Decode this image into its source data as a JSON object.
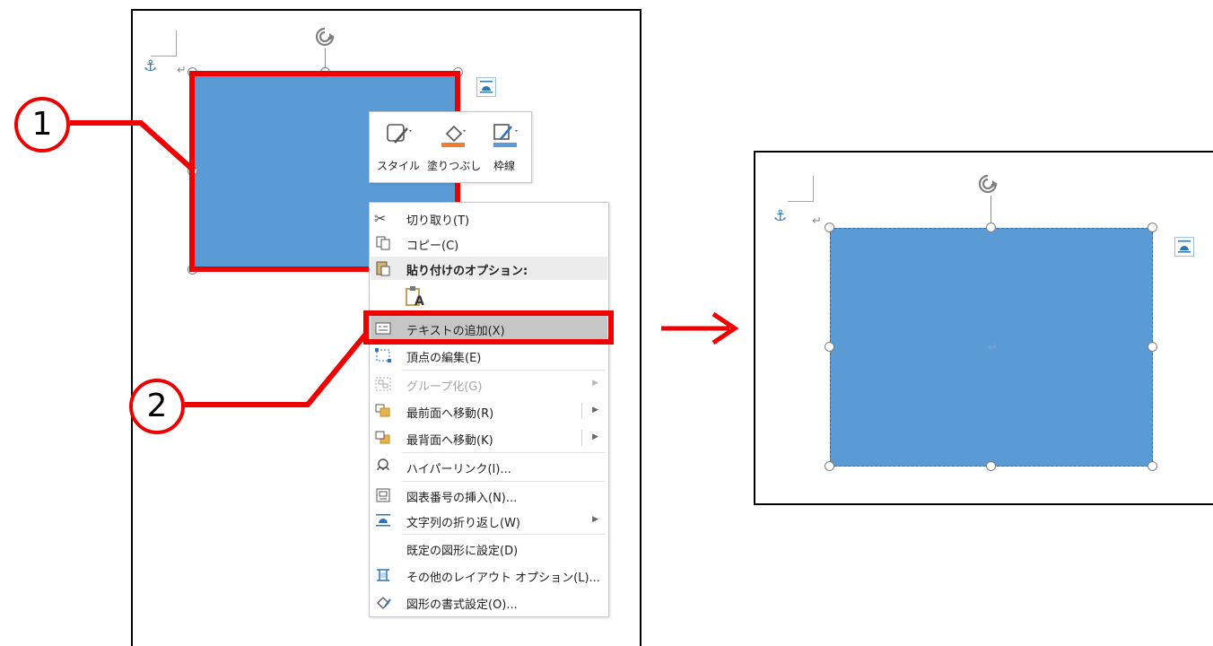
{
  "left_panel": {
    "mini_toolbar": {
      "style_label": "スタイル",
      "fill_label": "塗りつぶし",
      "outline_label": "枠線"
    },
    "context_menu": {
      "items": [
        {
          "label": "切り取り(T)",
          "icon": "scissors-icon"
        },
        {
          "label": "コピー(C)",
          "icon": "copy-icon"
        },
        {
          "label": "貼り付けのオプション:",
          "icon": "paste-icon"
        },
        {
          "label": "A",
          "icon": "paste-keep-text-icon"
        },
        {
          "label": "テキストの追加(X)",
          "icon": "text-box-icon"
        },
        {
          "label": "頂点の編集(E)",
          "icon": "edit-points-icon"
        },
        {
          "label": "グループ化(G)",
          "icon": "group-icon"
        },
        {
          "label": "最前面へ移動(R)",
          "icon": "bring-front-icon"
        },
        {
          "label": "最背面へ移動(K)",
          "icon": "send-back-icon"
        },
        {
          "label": "ハイパーリンク(I)...",
          "icon": "link-icon"
        },
        {
          "label": "図表番号の挿入(N)...",
          "icon": "caption-icon"
        },
        {
          "label": "文字列の折り返し(W)",
          "icon": "wrap-text-icon"
        },
        {
          "label": "既定の図形に設定(D)",
          "icon": ""
        },
        {
          "label": "その他のレイアウト オプション(L)...",
          "icon": "layout-options-icon"
        },
        {
          "label": "図形の書式設定(O)...",
          "icon": "format-shape-icon"
        }
      ]
    },
    "paragraph_mark": "↵",
    "anchor_glyph": "⚓"
  },
  "callouts": {
    "one": "1",
    "two": "2"
  },
  "arrow_glyph": "→",
  "right_panel": {
    "paragraph_mark": "↵",
    "anchor_glyph": "⚓",
    "inner_paragraph_mark": "↵"
  },
  "colors": {
    "shape_fill": "#5b9bd5",
    "highlight": "#ee0000",
    "menu_highlight": "#c6c6c6"
  }
}
